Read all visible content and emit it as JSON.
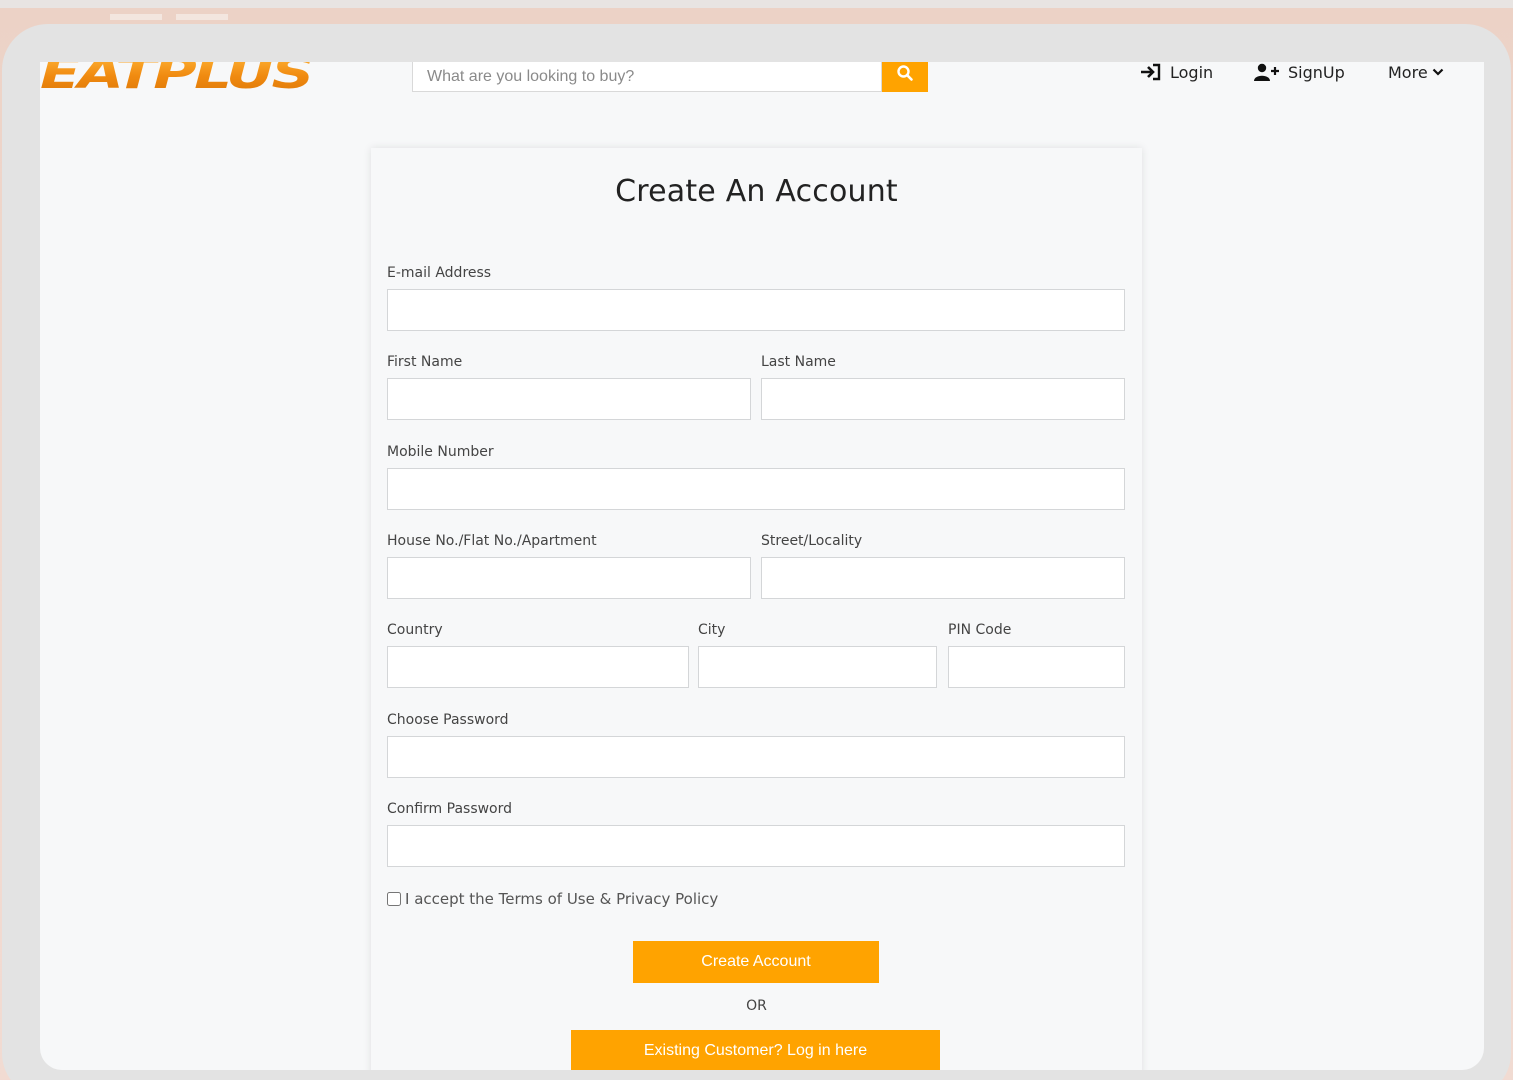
{
  "header": {
    "logo_text": "EATPLUS",
    "search": {
      "placeholder": "What are you looking to buy?",
      "icon": "search-icon"
    },
    "nav": {
      "login_label": "Login",
      "signup_label": "SignUp",
      "more_label": "More"
    }
  },
  "form": {
    "title": "Create An Account",
    "fields": {
      "email": {
        "label": "E-mail Address",
        "value": ""
      },
      "first_name": {
        "label": "First Name",
        "value": ""
      },
      "last_name": {
        "label": "Last Name",
        "value": ""
      },
      "mobile": {
        "label": "Mobile Number",
        "value": ""
      },
      "house": {
        "label": "House No./Flat No./Apartment",
        "value": ""
      },
      "street": {
        "label": "Street/Locality",
        "value": ""
      },
      "country": {
        "label": "Country",
        "value": ""
      },
      "city": {
        "label": "City",
        "value": ""
      },
      "pin": {
        "label": "PIN Code",
        "value": ""
      },
      "password": {
        "label": "Choose Password",
        "value": ""
      },
      "confirm_password": {
        "label": "Confirm Password",
        "value": ""
      }
    },
    "terms_label": "I accept the Terms of Use & Privacy Policy",
    "create_button_label": "Create Account",
    "or_label": "OR",
    "existing_button_label": "Existing Customer? Log in here"
  },
  "colors": {
    "accent": "#ffa300",
    "logo": "#f29a1c",
    "background": "#f7f8f9"
  }
}
